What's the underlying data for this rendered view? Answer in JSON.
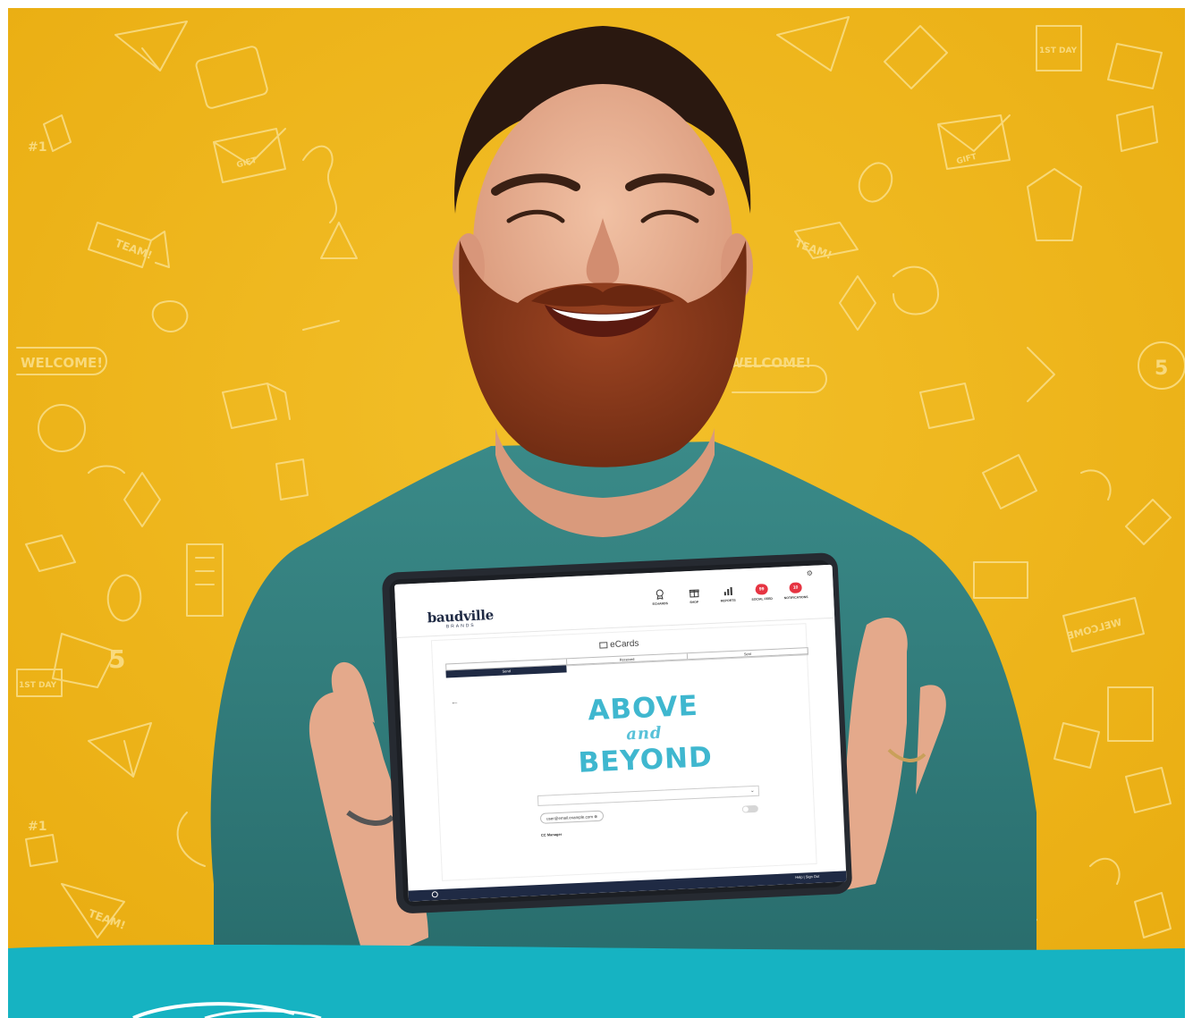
{
  "colors": {
    "background_yellow": "#f0b81b",
    "doodle_line": "#f9dc82",
    "banner_teal": "#16b3c2",
    "shirt_teal": "#2e7b7a",
    "beard": "#8b3d1c",
    "tablet_frame": "#262a31",
    "navy": "#1f2a44",
    "badge_red": "#e63442",
    "card_cyan": "#3fb7cf"
  },
  "doodles": {
    "welcome_left": "WELCOME!",
    "welcome_right": "WELCOME!",
    "team": "TEAM!",
    "gift": "GIFT",
    "first_day": "1ST DAY",
    "mirrored_welcome": "WELCOME",
    "number_five": "5",
    "number_one": "#1"
  },
  "tablet": {
    "logo_brand": "baudville",
    "logo_sub": "BRANDS",
    "nav": [
      {
        "icon": "award-icon",
        "label": "ECHARDS"
      },
      {
        "icon": "gift-icon",
        "label": "SHOP"
      },
      {
        "icon": "chart-icon",
        "label": "REPORTS"
      },
      {
        "icon": "badge",
        "badge": "99",
        "label": "SOCIAL FEED"
      },
      {
        "icon": "badge",
        "badge": "10",
        "label": "NOTIFICATIONS"
      }
    ],
    "page_title": "eCards",
    "tabs": [
      "",
      "Received",
      "Sent"
    ],
    "steps": [
      "Send",
      "",
      ""
    ],
    "card": {
      "line1": "ABOVE",
      "line2": "and",
      "line3": "BEYOND"
    },
    "recipient_chip": "user@email.example.com ⊗",
    "cc_label": "CC Manager",
    "footer_links": "Help | Sign Out"
  }
}
